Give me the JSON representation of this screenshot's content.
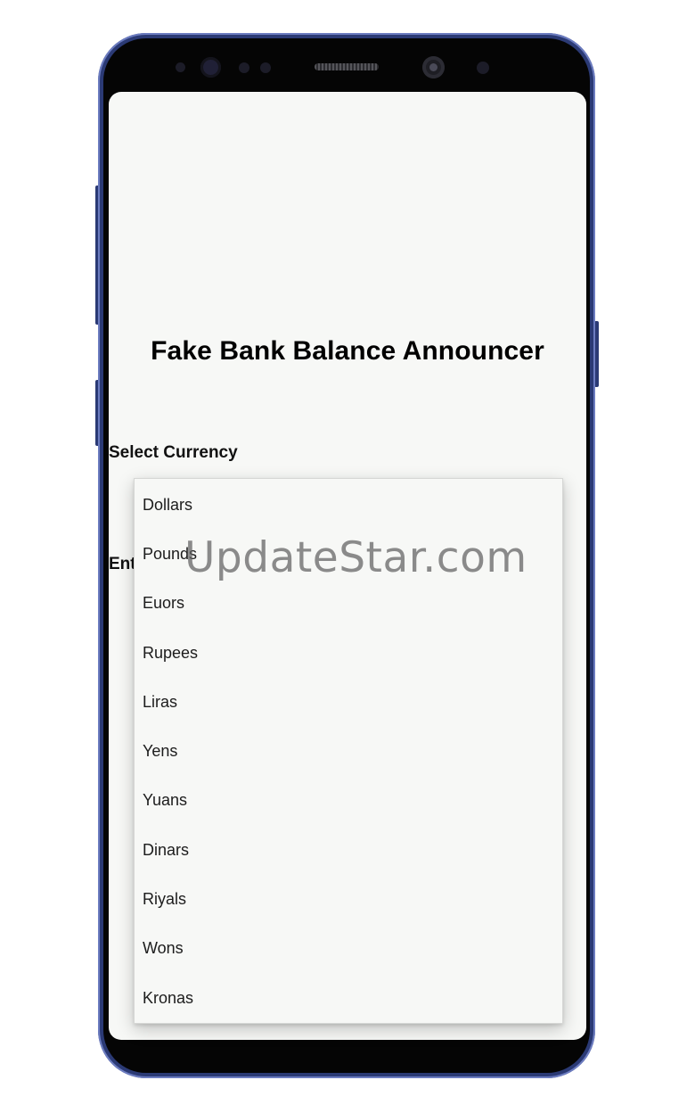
{
  "app": {
    "title": "Fake Bank Balance Announcer",
    "select_currency_label": "Select Currency",
    "enter_amount_label_partial": "Ent"
  },
  "dropdown": {
    "options": [
      "Dollars",
      "Pounds",
      "Euors",
      "Rupees",
      "Liras",
      "Yens",
      "Yuans",
      "Dinars",
      "Riyals",
      "Wons",
      "Kronas"
    ]
  },
  "watermark": {
    "text": "UpdateStar.com"
  },
  "colors": {
    "phone_frame": "#2b3a75",
    "screen_background": "#f7f8f6",
    "text": "#111111"
  }
}
